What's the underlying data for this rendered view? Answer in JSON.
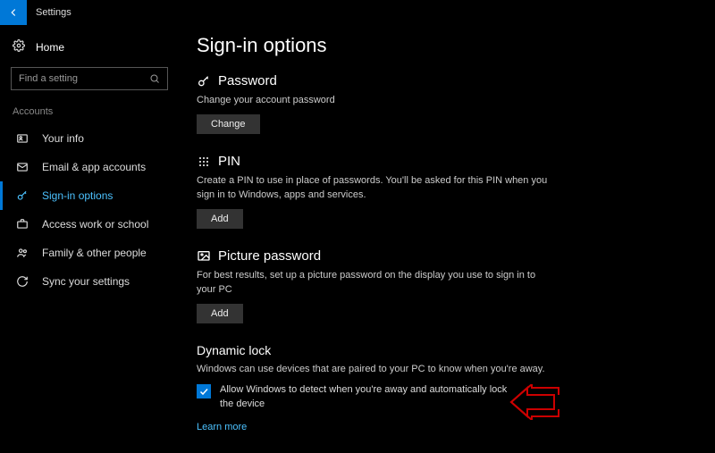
{
  "titlebar": {
    "title": "Settings"
  },
  "sidebar": {
    "home": "Home",
    "search_placeholder": "Find a setting",
    "group": "Accounts",
    "items": [
      {
        "label": "Your info"
      },
      {
        "label": "Email & app accounts"
      },
      {
        "label": "Sign-in options"
      },
      {
        "label": "Access work or school"
      },
      {
        "label": "Family & other people"
      },
      {
        "label": "Sync your settings"
      }
    ]
  },
  "main": {
    "title": "Sign-in options",
    "password": {
      "heading": "Password",
      "desc": "Change your account password",
      "button": "Change"
    },
    "pin": {
      "heading": "PIN",
      "desc": "Create a PIN to use in place of passwords. You'll be asked for this PIN when you sign in to Windows, apps and services.",
      "button": "Add"
    },
    "picture": {
      "heading": "Picture password",
      "desc": "For best results, set up a picture password on the display you use to sign in to your PC",
      "button": "Add"
    },
    "dynamic": {
      "heading": "Dynamic lock",
      "desc": "Windows can use devices that are paired to your PC to know when you're away.",
      "checkbox_label": "Allow Windows to detect when you're away and automatically lock the device",
      "learn_more": "Learn more"
    }
  }
}
